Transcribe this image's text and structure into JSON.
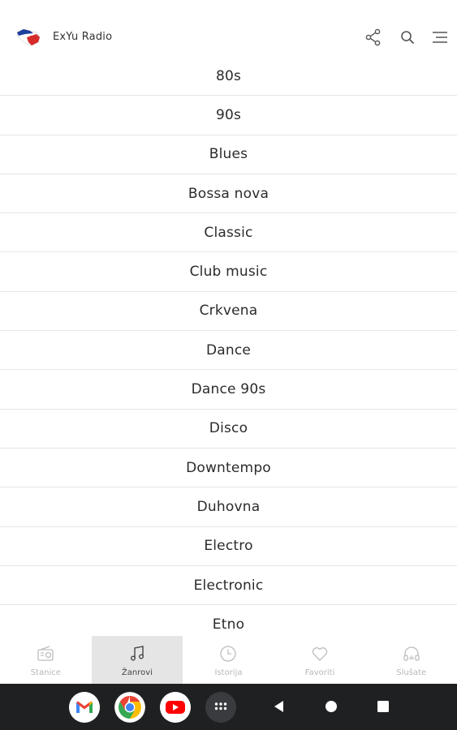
{
  "app": {
    "title": "ExYu Radio"
  },
  "genres": [
    "80s",
    "90s",
    "Blues",
    "Bossa nova",
    "Classic",
    "Club music",
    "Crkvena",
    "Dance",
    "Dance 90s",
    "Disco",
    "Downtempo",
    "Duhovna",
    "Electro",
    "Electronic",
    "Etno"
  ],
  "bottom_nav": {
    "stanice": "Stanice",
    "zanrovi": "Žanrovi",
    "istorija": "Istorija",
    "favoriti": "Favoriti",
    "slusate": "Slušate",
    "active": "Žanrovi"
  },
  "colors": {
    "accent_active_bg": "#e5e5e5",
    "nav_inactive": "#b7b7b7",
    "system_bar": "#1f2022"
  },
  "icons": {
    "appbar": [
      "share-icon",
      "search-icon",
      "menu-icon"
    ],
    "nav": [
      "radio-icon",
      "music-note-icon",
      "clock-icon",
      "heart-icon",
      "headphones-icon"
    ],
    "system": [
      "gmail-icon",
      "chrome-icon",
      "youtube-icon",
      "app-launcher-icon",
      "back-icon",
      "home-icon",
      "recents-icon"
    ]
  }
}
